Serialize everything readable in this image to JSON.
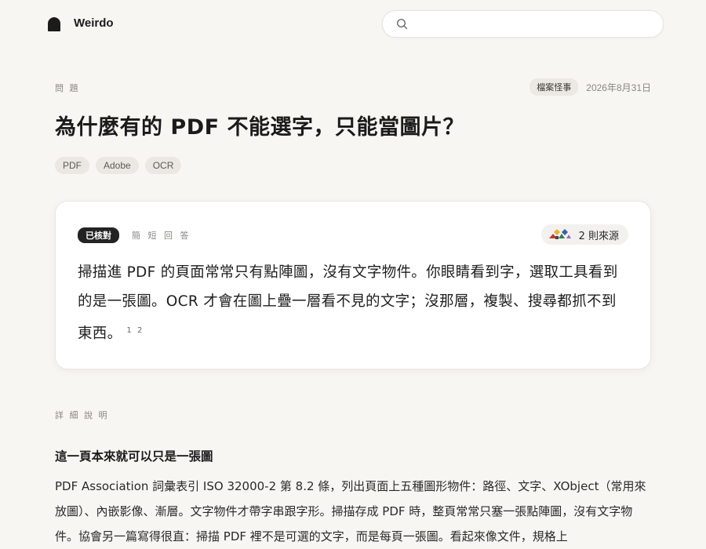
{
  "header": {
    "brand": "Weirdo",
    "search_placeholder": ""
  },
  "article": {
    "section": "問 題",
    "category": "檔案怪事",
    "date": "2026年8月31日",
    "title": "為什麼有的 PDF 不能選字，只能當圖片？",
    "tags": [
      "PDF",
      "Adobe",
      "OCR"
    ]
  },
  "answer_card": {
    "badge": "已核對",
    "label": "簡 短 回 答",
    "sources_label": "2 則來源",
    "text": "掃描進 PDF 的頁面常常只有點陣圖，沒有文字物件。你眼睛看到字，選取工具看到的是一張圖。OCR 才會在圖上疊一層看不見的文字；沒那層，複製、搜尋都抓不到東西。",
    "citations": "1 2"
  },
  "details": {
    "section": "詳 細 說 明",
    "heading": "這一頁本來就可以只是一張圖",
    "body": "PDF Association 詞彙表引 ISO 32000-2 第 8.2 條，列出頁面上五種圖形物件：路徑、文字、XObject（常用來放圖）、內嵌影像、漸層。文字物件才帶字串跟字形。掃描存成 PDF 時，整頁常常只塞一張點陣圖，沒有文字物件。協會另一篇寫得很直：掃描 PDF 裡不是可選的文字，而是每頁一張圖。看起來像文件，規格上"
  }
}
